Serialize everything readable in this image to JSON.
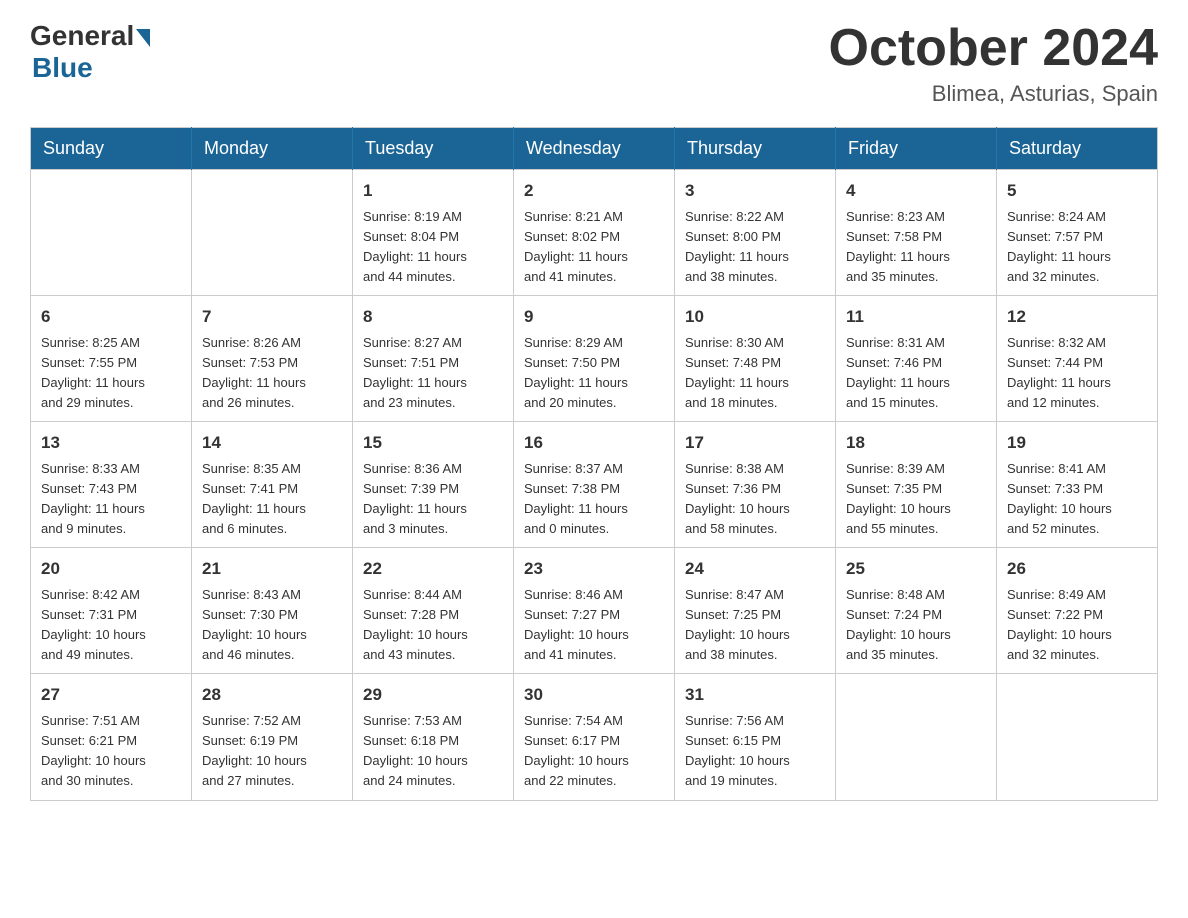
{
  "header": {
    "logo_general": "General",
    "logo_blue": "Blue",
    "month_title": "October 2024",
    "location": "Blimea, Asturias, Spain"
  },
  "days_of_week": [
    "Sunday",
    "Monday",
    "Tuesday",
    "Wednesday",
    "Thursday",
    "Friday",
    "Saturday"
  ],
  "weeks": [
    [
      {
        "day": "",
        "info": ""
      },
      {
        "day": "",
        "info": ""
      },
      {
        "day": "1",
        "info": "Sunrise: 8:19 AM\nSunset: 8:04 PM\nDaylight: 11 hours\nand 44 minutes."
      },
      {
        "day": "2",
        "info": "Sunrise: 8:21 AM\nSunset: 8:02 PM\nDaylight: 11 hours\nand 41 minutes."
      },
      {
        "day": "3",
        "info": "Sunrise: 8:22 AM\nSunset: 8:00 PM\nDaylight: 11 hours\nand 38 minutes."
      },
      {
        "day": "4",
        "info": "Sunrise: 8:23 AM\nSunset: 7:58 PM\nDaylight: 11 hours\nand 35 minutes."
      },
      {
        "day": "5",
        "info": "Sunrise: 8:24 AM\nSunset: 7:57 PM\nDaylight: 11 hours\nand 32 minutes."
      }
    ],
    [
      {
        "day": "6",
        "info": "Sunrise: 8:25 AM\nSunset: 7:55 PM\nDaylight: 11 hours\nand 29 minutes."
      },
      {
        "day": "7",
        "info": "Sunrise: 8:26 AM\nSunset: 7:53 PM\nDaylight: 11 hours\nand 26 minutes."
      },
      {
        "day": "8",
        "info": "Sunrise: 8:27 AM\nSunset: 7:51 PM\nDaylight: 11 hours\nand 23 minutes."
      },
      {
        "day": "9",
        "info": "Sunrise: 8:29 AM\nSunset: 7:50 PM\nDaylight: 11 hours\nand 20 minutes."
      },
      {
        "day": "10",
        "info": "Sunrise: 8:30 AM\nSunset: 7:48 PM\nDaylight: 11 hours\nand 18 minutes."
      },
      {
        "day": "11",
        "info": "Sunrise: 8:31 AM\nSunset: 7:46 PM\nDaylight: 11 hours\nand 15 minutes."
      },
      {
        "day": "12",
        "info": "Sunrise: 8:32 AM\nSunset: 7:44 PM\nDaylight: 11 hours\nand 12 minutes."
      }
    ],
    [
      {
        "day": "13",
        "info": "Sunrise: 8:33 AM\nSunset: 7:43 PM\nDaylight: 11 hours\nand 9 minutes."
      },
      {
        "day": "14",
        "info": "Sunrise: 8:35 AM\nSunset: 7:41 PM\nDaylight: 11 hours\nand 6 minutes."
      },
      {
        "day": "15",
        "info": "Sunrise: 8:36 AM\nSunset: 7:39 PM\nDaylight: 11 hours\nand 3 minutes."
      },
      {
        "day": "16",
        "info": "Sunrise: 8:37 AM\nSunset: 7:38 PM\nDaylight: 11 hours\nand 0 minutes."
      },
      {
        "day": "17",
        "info": "Sunrise: 8:38 AM\nSunset: 7:36 PM\nDaylight: 10 hours\nand 58 minutes."
      },
      {
        "day": "18",
        "info": "Sunrise: 8:39 AM\nSunset: 7:35 PM\nDaylight: 10 hours\nand 55 minutes."
      },
      {
        "day": "19",
        "info": "Sunrise: 8:41 AM\nSunset: 7:33 PM\nDaylight: 10 hours\nand 52 minutes."
      }
    ],
    [
      {
        "day": "20",
        "info": "Sunrise: 8:42 AM\nSunset: 7:31 PM\nDaylight: 10 hours\nand 49 minutes."
      },
      {
        "day": "21",
        "info": "Sunrise: 8:43 AM\nSunset: 7:30 PM\nDaylight: 10 hours\nand 46 minutes."
      },
      {
        "day": "22",
        "info": "Sunrise: 8:44 AM\nSunset: 7:28 PM\nDaylight: 10 hours\nand 43 minutes."
      },
      {
        "day": "23",
        "info": "Sunrise: 8:46 AM\nSunset: 7:27 PM\nDaylight: 10 hours\nand 41 minutes."
      },
      {
        "day": "24",
        "info": "Sunrise: 8:47 AM\nSunset: 7:25 PM\nDaylight: 10 hours\nand 38 minutes."
      },
      {
        "day": "25",
        "info": "Sunrise: 8:48 AM\nSunset: 7:24 PM\nDaylight: 10 hours\nand 35 minutes."
      },
      {
        "day": "26",
        "info": "Sunrise: 8:49 AM\nSunset: 7:22 PM\nDaylight: 10 hours\nand 32 minutes."
      }
    ],
    [
      {
        "day": "27",
        "info": "Sunrise: 7:51 AM\nSunset: 6:21 PM\nDaylight: 10 hours\nand 30 minutes."
      },
      {
        "day": "28",
        "info": "Sunrise: 7:52 AM\nSunset: 6:19 PM\nDaylight: 10 hours\nand 27 minutes."
      },
      {
        "day": "29",
        "info": "Sunrise: 7:53 AM\nSunset: 6:18 PM\nDaylight: 10 hours\nand 24 minutes."
      },
      {
        "day": "30",
        "info": "Sunrise: 7:54 AM\nSunset: 6:17 PM\nDaylight: 10 hours\nand 22 minutes."
      },
      {
        "day": "31",
        "info": "Sunrise: 7:56 AM\nSunset: 6:15 PM\nDaylight: 10 hours\nand 19 minutes."
      },
      {
        "day": "",
        "info": ""
      },
      {
        "day": "",
        "info": ""
      }
    ]
  ]
}
